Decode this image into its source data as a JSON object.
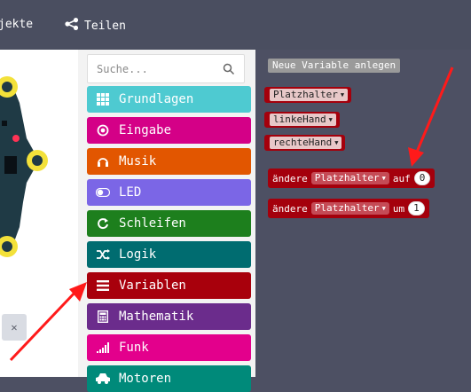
{
  "topbar": {
    "projects_label": "jekte",
    "share_label": "Teilen"
  },
  "search": {
    "placeholder": "Suche..."
  },
  "categories": [
    {
      "label": "Grundlagen",
      "color": "#1e90ff",
      "icon": "grid-icon"
    },
    {
      "label": "Eingabe",
      "color": "#d400d4",
      "icon": "target-icon"
    },
    {
      "label": "Musik",
      "color": "#e63022",
      "icon": "headphones-icon"
    },
    {
      "label": "LED",
      "color": "#5c2d91",
      "icon": "toggle-icon"
    },
    {
      "label": "Schleifen",
      "color": "#00aa00",
      "icon": "loop-icon"
    },
    {
      "label": "Logik",
      "color": "#00a4a6",
      "icon": "shuffle-icon"
    },
    {
      "label": "Variablen",
      "color": "#dc143c",
      "icon": "list-icon"
    },
    {
      "label": "Mathematik",
      "color": "#9400d3",
      "icon": "calculator-icon"
    },
    {
      "label": "Funk",
      "color": "#e3008c",
      "icon": "signal-icon"
    },
    {
      "label": "Motoren",
      "color": "#00806f",
      "icon": "car-icon"
    }
  ],
  "workspace": {
    "new_variable_label": "Neue Variable anlegen",
    "variables": [
      "Platzhalter",
      "linkeHand",
      "rechteHand"
    ],
    "set_block": {
      "prefix": "ändere",
      "variable": "Platzhalter",
      "middle": "auf",
      "value": "0"
    },
    "change_block": {
      "prefix": "ändere",
      "variable": "Platzhalter",
      "middle": "um",
      "value": "1"
    }
  },
  "colors": {
    "background": "#4d5063",
    "variable_block": "#a4000c",
    "annotation_arrow": "#ff1a1a"
  }
}
